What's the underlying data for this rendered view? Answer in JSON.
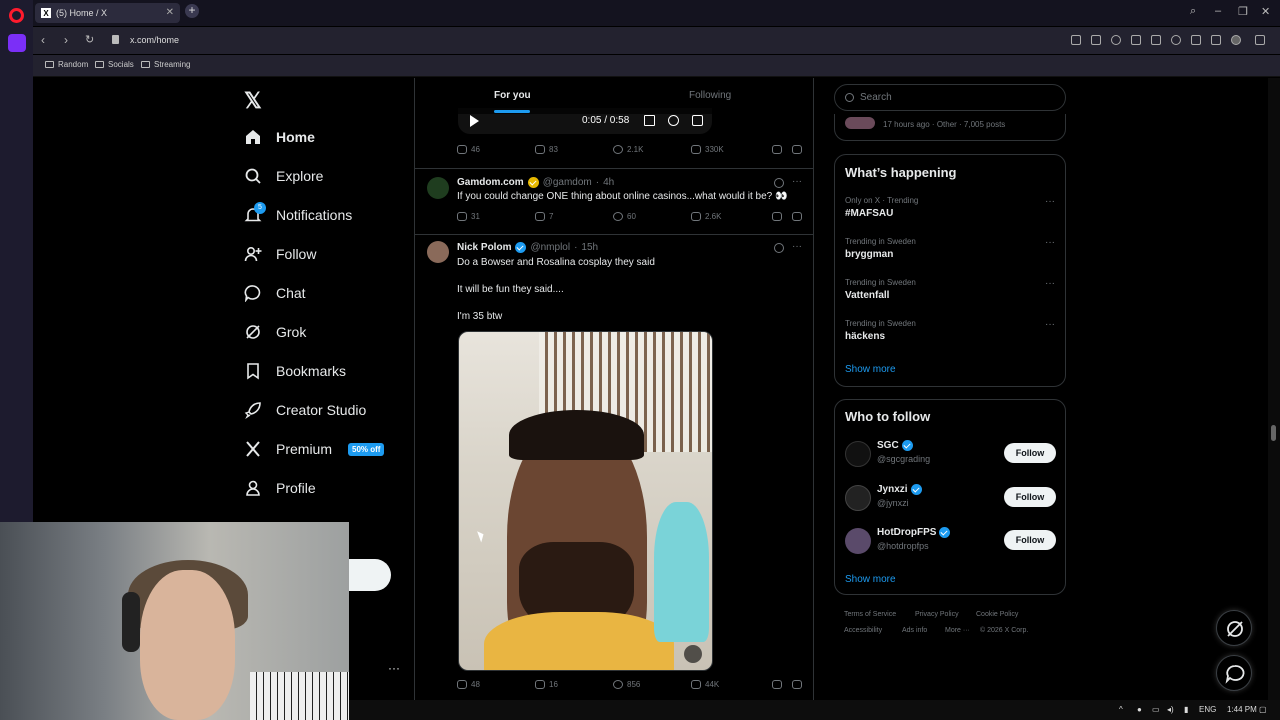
{
  "browser": {
    "tab_title": "(5) Home / X",
    "url": "x.com/home",
    "bookmarks": [
      "Random",
      "Socials",
      "Streaming"
    ]
  },
  "nav": {
    "items": [
      {
        "label": "Home",
        "icon": "home-icon"
      },
      {
        "label": "Explore",
        "icon": "search-icon"
      },
      {
        "label": "Notifications",
        "icon": "bell-icon",
        "badge": "5"
      },
      {
        "label": "Follow",
        "icon": "add-person-icon"
      },
      {
        "label": "Chat",
        "icon": "chat-bubble-icon"
      },
      {
        "label": "Grok",
        "icon": "grok-icon"
      },
      {
        "label": "Bookmarks",
        "icon": "bookmark-icon"
      },
      {
        "label": "Creator Studio",
        "icon": "rocket-icon"
      },
      {
        "label": "Premium",
        "icon": "x-logo-icon",
        "promo": "50% off"
      },
      {
        "label": "Profile",
        "icon": "person-icon"
      }
    ]
  },
  "feed": {
    "tabs": {
      "for_you": "For you",
      "following": "Following"
    },
    "video": {
      "time": "0:05 / 0:58"
    },
    "post0_stats": {
      "replies": "46",
      "reposts": "83",
      "likes": "2.1K",
      "views": "330K"
    },
    "post1": {
      "name": "Gamdom.com",
      "handle": "@gamdom",
      "time": "4h",
      "text": "If you could change ONE thing about online casinos...what would it be? 👀",
      "stats": {
        "replies": "31",
        "reposts": "7",
        "likes": "60",
        "views": "2.6K"
      }
    },
    "post2": {
      "name": "Nick Polom",
      "handle": "@nmplol",
      "time": "15h",
      "line1": "Do a Bowser and Rosalina cosplay they said",
      "line2": "It will be fun they said....",
      "line3": "I'm 35 btw",
      "stats": {
        "replies": "48",
        "reposts": "16",
        "likes": "856",
        "views": "44K"
      }
    }
  },
  "sidebar": {
    "search_placeholder": "Search",
    "top_meta": "17 hours ago · Other · 7,005 posts",
    "happening_title": "What’s happening",
    "trends": [
      {
        "meta": "Only on X · Trending",
        "name": "#MAFSAU"
      },
      {
        "meta": "Trending in Sweden",
        "name": "bryggman"
      },
      {
        "meta": "Trending in Sweden",
        "name": "Vattenfall"
      },
      {
        "meta": "Trending in Sweden",
        "name": "häckens"
      }
    ],
    "show_more": "Show more",
    "wtf_title": "Who to follow",
    "wtf": [
      {
        "name": "SGC",
        "handle": "@sgcgrading",
        "button": "Follow"
      },
      {
        "name": "Jynxzi",
        "handle": "@jynxzi",
        "button": "Follow"
      },
      {
        "name": "HotDropFPS",
        "handle": "@hotdropfps",
        "button": "Follow"
      }
    ],
    "footer": [
      "Terms of Service",
      "Privacy Policy",
      "Cookie Policy",
      "Accessibility",
      "Ads info",
      "More ···",
      "© 2026 X Corp."
    ]
  },
  "taskbar": {
    "lang": "ENG",
    "time": "1:44 PM"
  },
  "colors": {
    "accent": "#1d9bf0",
    "background": "#000000",
    "border": "#2f3336",
    "muted": "#71767b"
  }
}
